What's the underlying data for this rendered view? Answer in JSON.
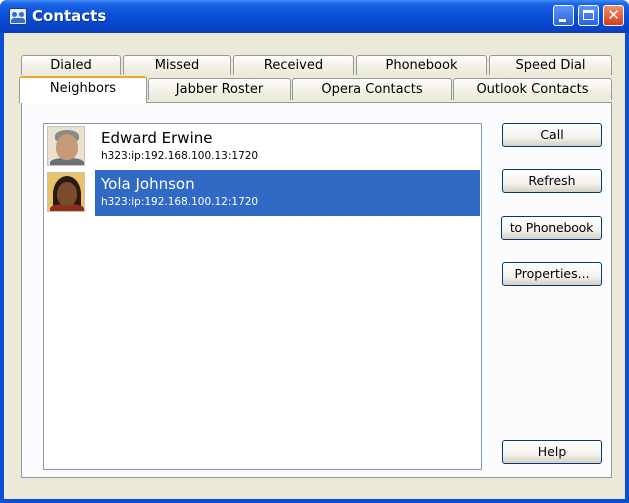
{
  "window": {
    "title": "Contacts",
    "minimize_icon": "minimize-icon",
    "maximize_icon": "maximize-icon",
    "close_icon": "close-icon",
    "close_glyph": "✕"
  },
  "tabs": {
    "row1": [
      "Dialed",
      "Missed",
      "Received",
      "Phonebook",
      "Speed Dial"
    ],
    "row2": [
      "Neighbors",
      "Jabber Roster",
      "Opera Contacts",
      "Outlook Contacts"
    ],
    "active": "Neighbors"
  },
  "contacts": [
    {
      "name": "Edward Erwine",
      "address": "h323:ip:192.168.100.13:1720",
      "selected": false
    },
    {
      "name": "Yola Johnson",
      "address": "h323:ip:192.168.100.12:1720",
      "selected": true
    }
  ],
  "buttons": {
    "call": "Call",
    "refresh": "Refresh",
    "to_phonebook": "to Phonebook",
    "properties": "Properties...",
    "help": "Help"
  },
  "colors": {
    "titlebar": "#0a4fd8",
    "selection": "#316ac5",
    "active_tab_accent": "#f0a536",
    "dialog_bg": "#ece9d8"
  }
}
